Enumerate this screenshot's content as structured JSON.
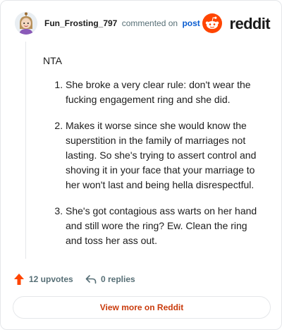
{
  "header": {
    "username": "Fun_Frosting_797",
    "action_text": "commented on",
    "post_link": "post",
    "brand_name": "reddit"
  },
  "comment": {
    "intro": "NTA",
    "points": [
      "She broke a very clear rule: don't wear the fucking engagement ring and she did.",
      "Makes it worse since she would know the superstition in the family of marriages not lasting. So she's trying to assert control and shoving it in your face that your marriage to her won't last and being hella disrespectful.",
      "She's got contagious ass warts on her hand and still wore the ring? Ew. Clean the ring and toss her ass out."
    ]
  },
  "footer": {
    "upvotes": "12 upvotes",
    "replies": "0 replies",
    "view_more": "View more on Reddit"
  },
  "icons": {
    "avatar": "avatar-icon",
    "brand_logo": "reddit-logo-icon",
    "upvote": "upvote-arrow-icon",
    "reply": "reply-arrow-icon"
  },
  "colors": {
    "brand_orange": "#ff4500",
    "upvote": "#ff4500",
    "link_blue": "#0a5cd0",
    "view_more_text": "#c93b0c",
    "muted": "#576f76"
  }
}
